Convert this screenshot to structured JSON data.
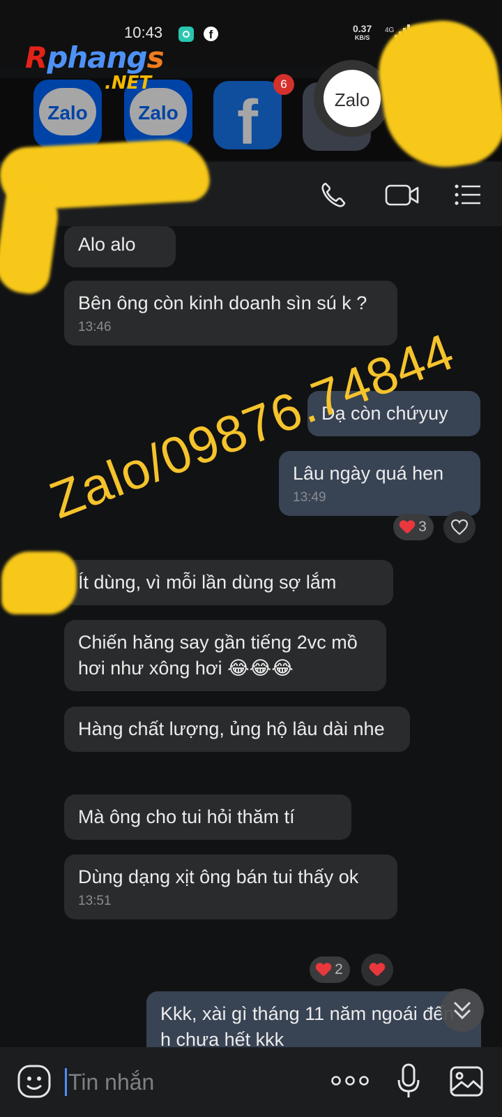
{
  "status_bar": {
    "time": "10:43",
    "speed_value": "0.37",
    "speed_unit": "KB/S",
    "network": "4G"
  },
  "branding": {
    "logo_r": "R",
    "logo_main": "phang",
    "logo_s": "s",
    "logo_net": ".NET"
  },
  "recent_apps": [
    {
      "name": "Zalo",
      "label": "Zalo"
    },
    {
      "name": "Zalo",
      "label": "Zalo"
    },
    {
      "name": "Facebook",
      "label": "f",
      "badge": "6"
    },
    {
      "name": "Zalo",
      "label": "Zalo"
    }
  ],
  "header": {
    "call_icon": "phone-icon",
    "video_icon": "video-icon",
    "menu_icon": "list-menu-icon"
  },
  "messages": [
    {
      "dir": "in",
      "text": "Alo alo",
      "time": ""
    },
    {
      "dir": "in",
      "text": "Bên ông còn kinh doanh sìn sú k ?",
      "time": "13:46"
    },
    {
      "dir": "out",
      "text": "Dạ còn chứyuy",
      "time": ""
    },
    {
      "dir": "out",
      "text": "Lâu ngày quá hen",
      "time": "13:49",
      "reaction_count": "3"
    },
    {
      "dir": "in",
      "text": "Ít dùng, vì mỗi lần dùng sợ lắm",
      "time": ""
    },
    {
      "dir": "in",
      "text": "Chiến hăng say gần tiếng 2vc mồ hơi như xông hơi 😂😂😂",
      "time": ""
    },
    {
      "dir": "in",
      "text": "Hàng chất lượng, ủng hộ lâu dài nhe",
      "time": ""
    },
    {
      "dir": "in",
      "text": "Mà ông cho tui hỏi thăm tí",
      "time": ""
    },
    {
      "dir": "in",
      "text": "Dùng dạng xịt ông bán tui thấy ok",
      "time": "13:51",
      "reaction_count": "2"
    },
    {
      "dir": "out",
      "text": "Kkk, xài gì tháng 11 năm ngoái đến h chưa hết kkk",
      "time": ""
    }
  ],
  "watermark": "Zalo/09876.74844",
  "composer": {
    "placeholder": "Tin nhắn",
    "more_icon": "more-dots-icon",
    "mic_icon": "microphone-icon",
    "image_icon": "image-icon",
    "sticker_icon": "sticker-icon"
  },
  "colors": {
    "incoming_bubble": "#2a2b2d",
    "outgoing_bubble": "#384354",
    "watermark": "#f5c32c",
    "censor_blob": "#f7c819"
  }
}
